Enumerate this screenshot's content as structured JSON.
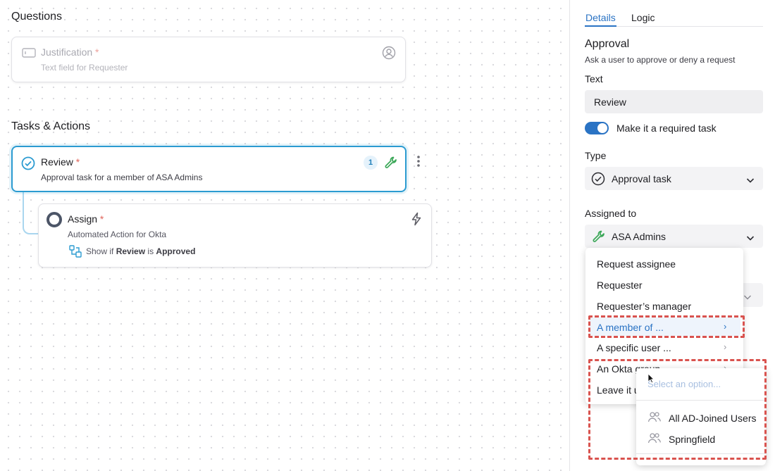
{
  "canvas": {
    "questions_title": "Questions",
    "justification": {
      "title": "Justification",
      "required_mark": "*",
      "subtitle": "Text field for Requester"
    },
    "tasks_title": "Tasks & Actions",
    "review": {
      "title": "Review",
      "required_mark": "*",
      "subtitle": "Approval task for a member of ASA Admins",
      "badge": "1"
    },
    "assign": {
      "title": "Assign",
      "required_mark": "*",
      "subtitle": "Automated Action for Okta",
      "condition_prefix": "Show if",
      "condition_field": "Review",
      "condition_mid": "is",
      "condition_value": "Approved"
    }
  },
  "panel": {
    "tabs": [
      "Details",
      "Logic"
    ],
    "active_tab": "Details",
    "heading": "Approval",
    "description": "Ask a user to approve or deny a request",
    "text_label": "Text",
    "text_value": "Review",
    "required_toggle_label": "Make it a required task",
    "required_toggle_on": true,
    "type_label": "Type",
    "type_value": "Approval task",
    "assigned_label": "Assigned to",
    "assigned_value": "ASA Admins"
  },
  "assign_menu": {
    "items": [
      {
        "label": "Request assignee"
      },
      {
        "label": "Requester"
      },
      {
        "label": "Requester’s manager"
      },
      {
        "label": "A member of ..."
      },
      {
        "label": "A specific user ..."
      },
      {
        "label": "An Okta group"
      },
      {
        "label": "Leave it u"
      }
    ],
    "highlighted_item": "A member of ..."
  },
  "group_submenu": {
    "placeholder": "Select an option...",
    "options": [
      "All AD-Joined Users",
      "Springfield"
    ]
  },
  "colors": {
    "accent": "#2a73c4",
    "selected_border": "#2b9bd1",
    "wrench_green": "#3aa757",
    "annotation_red": "#d9534f"
  }
}
